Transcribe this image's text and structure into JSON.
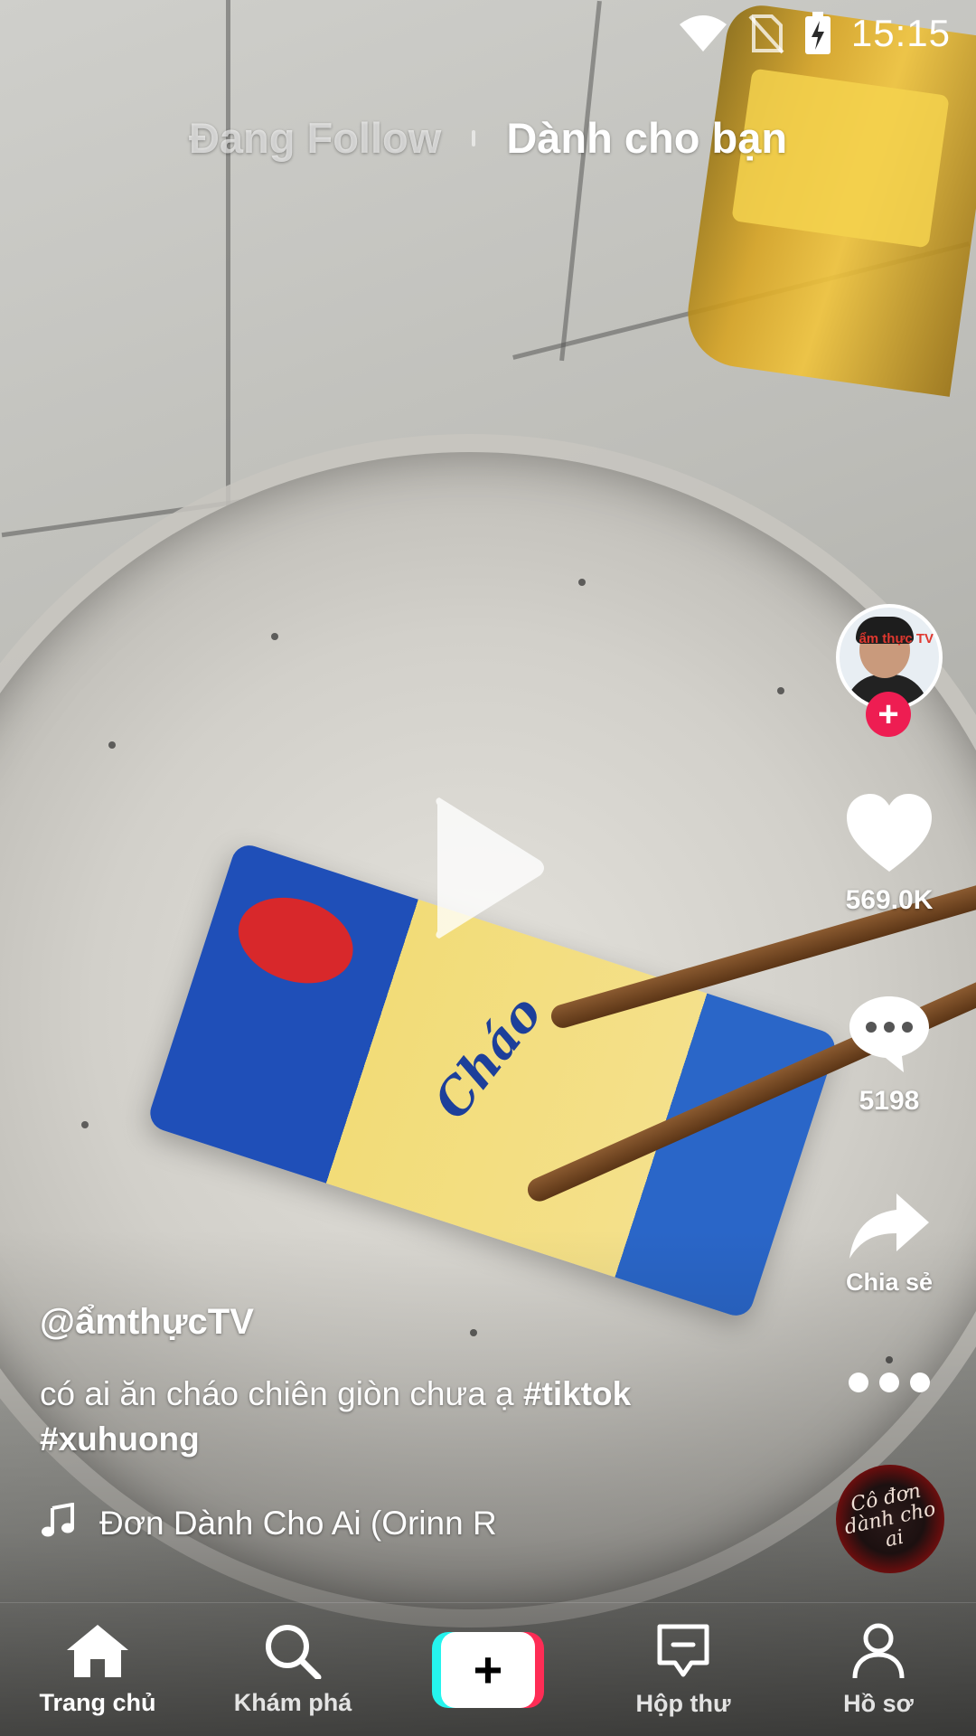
{
  "status_bar": {
    "time": "15:15",
    "icons": [
      "wifi-icon",
      "no-sim-icon",
      "battery-charging-icon"
    ]
  },
  "top_tabs": {
    "following": "Đang Follow",
    "for_you": "Dành cho bạn",
    "active": "for_you"
  },
  "video": {
    "state": "paused",
    "author": "@ẩmthựcTV",
    "caption_text": "có ai ăn cháo chiên giòn chưa ạ ",
    "hashtags": [
      "#tiktok",
      "#xuhuong"
    ],
    "sound_title": "Đơn Dành Cho Ai (Orinn R",
    "avatar_logo": "ẩm thực TV",
    "disc_text": "Cô đơn dành cho ai"
  },
  "actions": {
    "likes": "569.0K",
    "comments": "5198",
    "share_label": "Chia sẻ",
    "follow_plus": "+"
  },
  "bottom_nav": {
    "items": [
      {
        "label": "Trang chủ",
        "icon": "home-icon",
        "active": true
      },
      {
        "label": "Khám phá",
        "icon": "search-icon",
        "active": false
      },
      {
        "label": "+",
        "icon": "create-icon",
        "active": false
      },
      {
        "label": "Hộp thư",
        "icon": "inbox-icon",
        "active": false
      },
      {
        "label": "Hồ sơ",
        "icon": "profile-icon",
        "active": false
      }
    ]
  },
  "colors": {
    "accent_pink": "#fe2c55",
    "accent_cyan": "#25f4ee",
    "follow_red": "#ee1d52"
  }
}
